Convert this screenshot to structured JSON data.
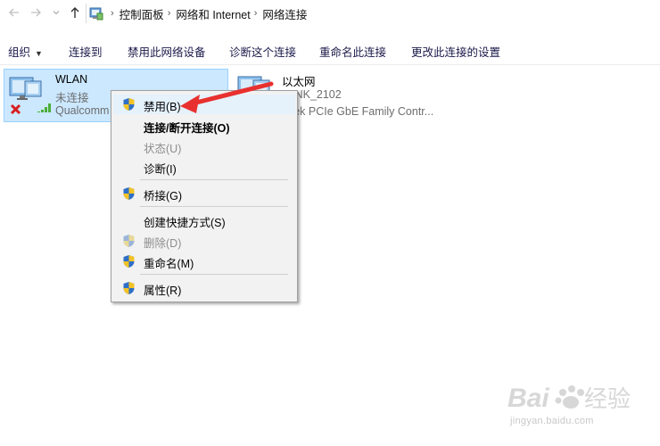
{
  "addressbar": {
    "back_icon": "arrow-left-icon",
    "forward_icon": "arrow-right-icon",
    "recent_icon": "chevron-down-icon",
    "up_icon": "arrow-up-icon",
    "breadcrumb": [
      "控制面板",
      "网络和 Internet",
      "网络连接"
    ]
  },
  "commandbar": {
    "organize": "组织",
    "connect": "连接到",
    "disable": "禁用此网络设备",
    "diagnose": "诊断这个连接",
    "rename": "重命名此连接",
    "change_settings": "更改此连接的设置"
  },
  "connections": [
    {
      "name": "WLAN",
      "status": "未连接",
      "device": "Qualcomm",
      "icon": "wireless-adapter-icon",
      "selected": true
    },
    {
      "name": "以太网",
      "status": "-LINK_2102",
      "device": "altek PCIe GbE Family Contr...",
      "icon": "ethernet-adapter-icon",
      "selected": false
    }
  ],
  "context_menu": {
    "items": [
      {
        "label": "禁用(B)",
        "shield": true,
        "enabled": true,
        "bold": false
      },
      {
        "label": "连接/断开连接(O)",
        "shield": false,
        "enabled": true,
        "bold": true
      },
      {
        "label": "状态(U)",
        "shield": false,
        "enabled": false,
        "bold": false
      },
      {
        "label": "诊断(I)",
        "shield": false,
        "enabled": true,
        "bold": false
      },
      {
        "label": "桥接(G)",
        "shield": true,
        "enabled": true,
        "bold": false
      },
      {
        "label": "创建快捷方式(S)",
        "shield": false,
        "enabled": true,
        "bold": false
      },
      {
        "label": "删除(D)",
        "shield": true,
        "enabled": false,
        "bold": false
      },
      {
        "label": "重命名(M)",
        "shield": true,
        "enabled": true,
        "bold": false
      },
      {
        "label": "属性(R)",
        "shield": true,
        "enabled": true,
        "bold": false
      }
    ]
  },
  "annotation": {
    "arrow_color": "#e8312f",
    "target": "禁用(B)"
  },
  "watermark": {
    "logo": "Baidu经验",
    "url": "jingyan.baidu.com"
  },
  "colors": {
    "selection_bg": "#cce8ff",
    "selection_border": "#99d1ff",
    "menu_bg": "#f2f2f2",
    "shield_blue": "#2f6fc7",
    "shield_yellow": "#f3c326"
  }
}
